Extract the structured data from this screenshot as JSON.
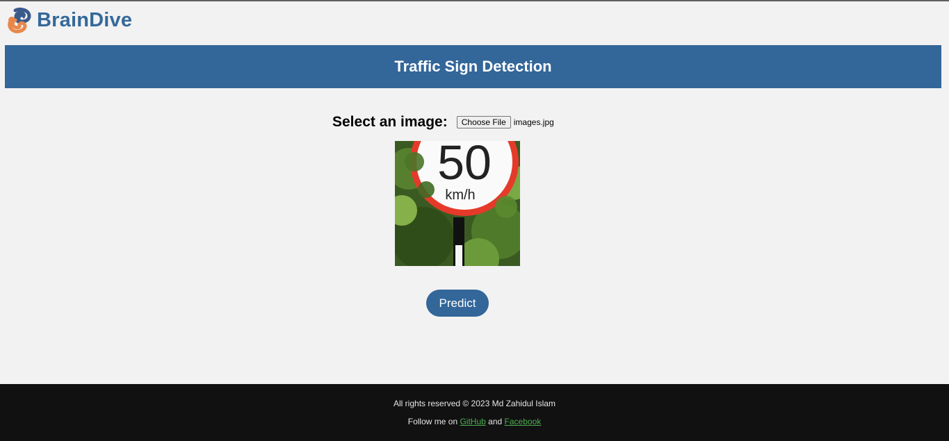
{
  "brand": {
    "name": "BrainDive",
    "color": "#34699a"
  },
  "banner": {
    "title": "Traffic Sign Detection",
    "color": "#336699"
  },
  "upload": {
    "label": "Select an image:",
    "button_label": "Choose File",
    "file_name": "images.jpg"
  },
  "preview": {
    "sign_number": "50",
    "sign_unit": "km/h"
  },
  "actions": {
    "predict_label": "Predict"
  },
  "footer": {
    "copyright": "All rights reserved © 2023 Md Zahidul Islam",
    "follow_prefix": "Follow me on",
    "github_label": "GitHub",
    "and_text": "and",
    "facebook_label": "Facebook",
    "link_color": "#4caf50"
  }
}
